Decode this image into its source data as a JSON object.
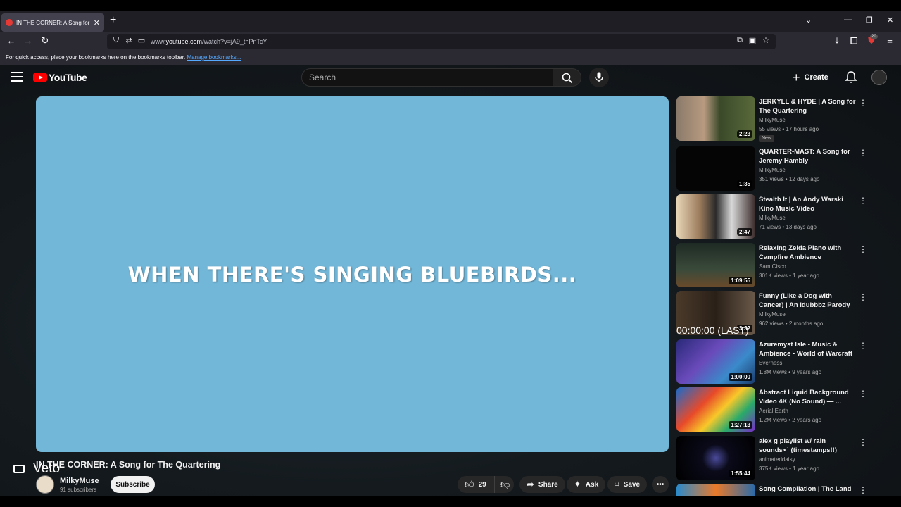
{
  "browser": {
    "tab_title": "IN THE CORNER: A Song for Th",
    "url_prefix": "www.",
    "url_domain": "youtube.com",
    "url_rest": "/watch?v=jA9_thPnTcY",
    "bookmarks_text": "For quick access, place your bookmarks here on the bookmarks toolbar.",
    "bookmarks_link": "Manage bookmarks...",
    "extension_badge": "20"
  },
  "masthead": {
    "logo_text": "YouTube",
    "search_placeholder": "Search",
    "create_label": "Create"
  },
  "player": {
    "caption": "WHEN THERE'S SINGING BLUEBIRDS..."
  },
  "video": {
    "title": "IN THE CORNER: A Song for The Quartering",
    "overlay_text": "Veto",
    "channel": "MilkyMuse",
    "subscribers": "91 subscribers",
    "subscribe_label": "Subscribe",
    "likes": "29",
    "share_label": "Share",
    "ask_label": "Ask",
    "save_label": "Save"
  },
  "recommendations": [
    {
      "title": "JERKYLL & HYDE | A Song for The Quartering",
      "channel": "MilkyMuse",
      "meta": "55 views • 17 hours ago",
      "duration": "2:23",
      "badge": "New",
      "bg": "linear-gradient(90deg,#8a7a6a 0%,#b89a80 35%,#3a4a2a 55%,#5a6a3a 100%)"
    },
    {
      "title": "QUARTER-MAST: A Song for Jeremy Hambly",
      "channel": "MilkyMuse",
      "meta": "351 views • 12 days ago",
      "duration": "1:35",
      "badge": "",
      "bg": "#050505"
    },
    {
      "title": "Stealth It | An Andy Warski Kino Music Video",
      "channel": "MilkyMuse",
      "meta": "71 views • 13 days ago",
      "duration": "2:47",
      "badge": "",
      "bg": "linear-gradient(90deg,#e8d7b8 0%,#9a7a5a 30%,#2a2a2a 50%,#d8d8d8 70%,#3a2a2a 100%)"
    },
    {
      "title": "Relaxing Zelda Piano with Campfire Ambience",
      "channel": "Sam Cisco",
      "meta": "301K views • 1 year ago",
      "duration": "1:09:55",
      "badge": "",
      "bg": "linear-gradient(180deg,#1e2a24 0%,#3a4a3a 60%,#6a4a2a 100%)"
    },
    {
      "title": "Funny (Like a Dog with Cancer) | An Idubbbz Parody Music Vide...",
      "channel": "MilkyMuse",
      "meta": "962 views • 2 months ago",
      "duration": "3:32",
      "badge": "",
      "bg": "linear-gradient(90deg,#4a3a2a 0%,#2a2018 50%,#6a5a4a 100%)"
    },
    {
      "title": "Azuremyst Isle - Music & Ambience - World of Warcraft",
      "channel": "Everness",
      "meta": "1.8M views • 9 years ago",
      "duration": "1:00:00",
      "badge": "",
      "bg": "linear-gradient(135deg,#2a2a7a 0%,#6a4aba 40%,#3a8aca 70%,#1a3a6a 100%)"
    },
    {
      "title": "Abstract Liquid Background Video 4K (No Sound) — ...",
      "channel": "Aerial Earth",
      "meta": "1.2M views • 2 years ago",
      "duration": "1:27:13",
      "badge": "",
      "bg": "linear-gradient(135deg,#1a6aca 0%,#e84a2a 35%,#f8c82a 55%,#2aaa6a 75%,#7a2aca 100%)"
    },
    {
      "title": "alex g playlist w/ rain sounds⋆˙ (timestamps!!)",
      "channel": "animateddaisy",
      "meta": "375K views • 1 year ago",
      "duration": "1:55:44",
      "badge": "",
      "bg": "radial-gradient(circle at 50% 50%,#4a4a9a 0%,#0a0a1a 30%,#000 100%)"
    },
    {
      "title": "Song Compilation | The Land",
      "channel": "",
      "meta": "",
      "duration": "",
      "badge": "",
      "bg": "linear-gradient(90deg,#2a8aca 0%,#e87a2a 50%,#2a6aaa 100%)"
    }
  ],
  "sidebar_overlay_text": "00:00:00 (LAST)"
}
